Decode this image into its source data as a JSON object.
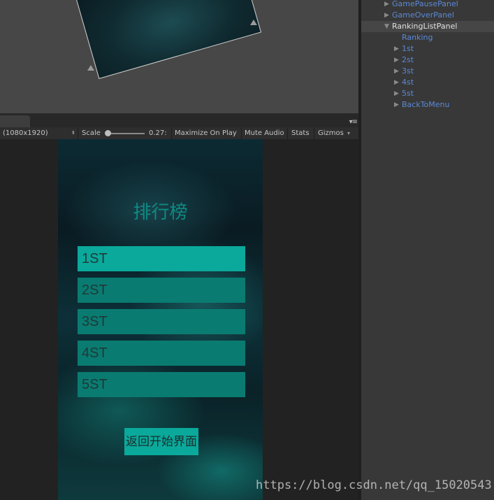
{
  "game_view": {
    "tab_label": "",
    "resolution": "(1080x1920)",
    "scale_label": "Scale",
    "scale_value": "0.27:",
    "maximize_on_play": "Maximize On Play",
    "mute_audio": "Mute Audio",
    "stats": "Stats",
    "gizmos": "Gizmos"
  },
  "ranking_ui": {
    "title": "排行榜",
    "rows": [
      "1ST",
      "2ST",
      "3ST",
      "4ST",
      "5ST"
    ],
    "back_button": "返回开始界面"
  },
  "hierarchy": {
    "items": [
      {
        "label": "GamePausePanel",
        "arrow": "▶",
        "selected": false
      },
      {
        "label": "GameOverPanel",
        "arrow": "▶",
        "selected": false
      },
      {
        "label": "RankingListPanel",
        "arrow": "▼",
        "selected": true
      },
      {
        "label": "Ranking",
        "arrow": "",
        "selected": false
      },
      {
        "label": "1st",
        "arrow": "▶",
        "selected": false
      },
      {
        "label": "2st",
        "arrow": "▶",
        "selected": false
      },
      {
        "label": "3st",
        "arrow": "▶",
        "selected": false
      },
      {
        "label": "4st",
        "arrow": "▶",
        "selected": false
      },
      {
        "label": "5st",
        "arrow": "▶",
        "selected": false
      },
      {
        "label": "BackToMenu",
        "arrow": "▶",
        "selected": false
      }
    ]
  },
  "watermark": "https://blog.csdn.net/qq_15020543",
  "colors": {
    "teal_button": "#0aa99b",
    "teal_row": "#0a7b71",
    "title_teal": "#0f8a83",
    "hierarchy_link": "#5b89d6"
  },
  "icons": {
    "tab_menu": "menu-icon",
    "dropdown": "dropdown-arrow-icon",
    "tree_expand": "triangle-right-icon",
    "tree_collapse": "triangle-down-icon"
  }
}
